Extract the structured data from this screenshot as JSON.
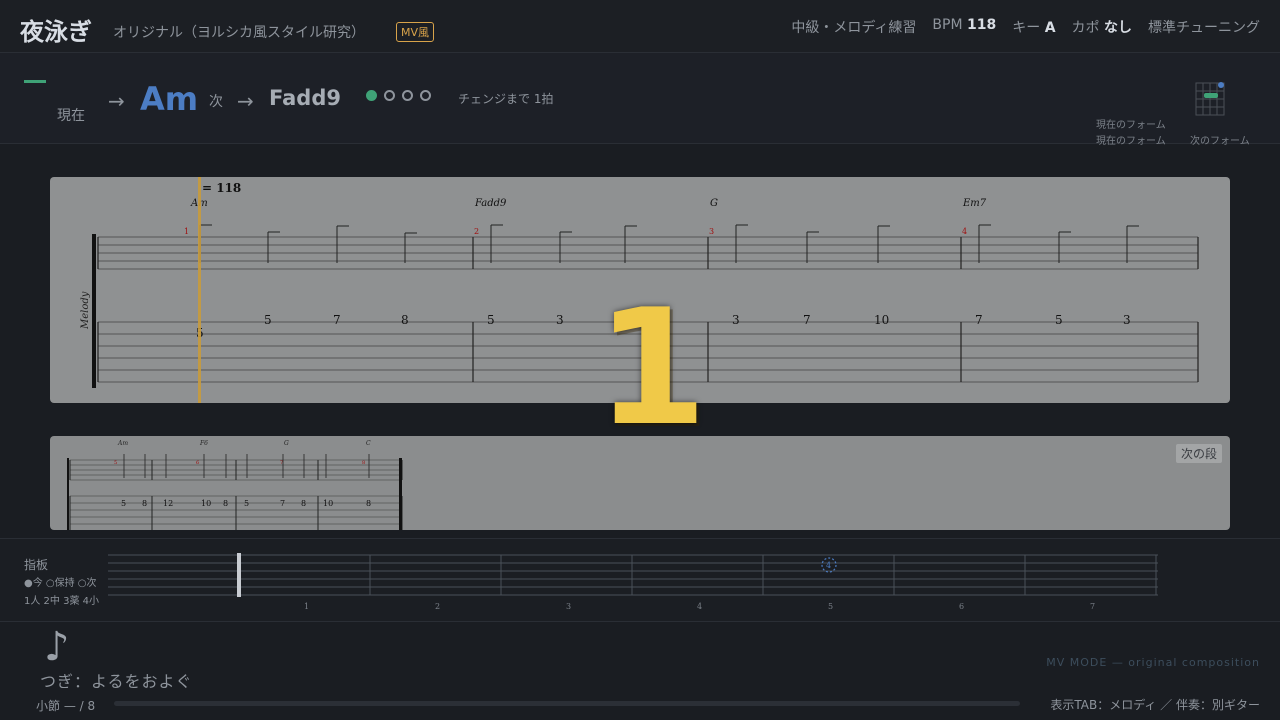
{
  "header": {
    "title": "夜泳ぎ",
    "subtitle": "オリジナル（ヨルシカ風スタイル研究）",
    "badge": "MV風",
    "level": "中級・メロディ練習",
    "bpm_label": "BPM",
    "bpm": "118",
    "key_label": "キー",
    "key": "A",
    "capo_label": "カポ",
    "capo": "なし",
    "tuning": "標準チューニング"
  },
  "chord_bar": {
    "now_label": "現在",
    "arrow": "→",
    "current_chord": "Am",
    "next_label": "次",
    "next_chord": "Fadd9",
    "beats": [
      true,
      false,
      false,
      false
    ],
    "until_change": "チェンジまで 1拍",
    "form_current_1": "現在のフォーム",
    "form_current_2": "現在のフォーム",
    "form_next": "次のフォーム",
    "accent_color": "#3fa277",
    "chord_color": "#4c7dc4"
  },
  "score": {
    "tempo": "= 118",
    "track_label": "Melody",
    "chords": [
      "Am",
      "Fadd9",
      "G",
      "Em7"
    ],
    "measure_numbers": [
      "1",
      "2",
      "3",
      "4"
    ],
    "measures": [
      [
        "5",
        "5",
        "7",
        "8"
      ],
      [
        "5",
        "3",
        "1",
        ""
      ],
      [
        "3",
        "7",
        "10"
      ],
      [
        "7",
        "5",
        "3"
      ]
    ],
    "playhead_color": "#c89b3c"
  },
  "next_system": {
    "label": "次の段",
    "chords": [
      "Am",
      "F6",
      "G",
      "C"
    ],
    "measure_numbers": [
      "5",
      "6",
      "7",
      "8"
    ],
    "measures": [
      [
        "5",
        "8",
        "12"
      ],
      [
        "10",
        "8",
        "5"
      ],
      [
        "7",
        "8",
        "10"
      ],
      [
        "8"
      ]
    ]
  },
  "countdown": "1",
  "fretboard": {
    "title": "指板",
    "legend": "●今 ○保持 ○次",
    "fingers": "1人 2中 3薬 4小",
    "fret_numbers": [
      "1",
      "2",
      "3",
      "4",
      "5",
      "6",
      "7"
    ],
    "marker_finger": "4"
  },
  "lyrics": {
    "note_icon": "♪",
    "next_line": "つぎ：よるをおよぐ"
  },
  "footer": {
    "measure": "小節 — / 8",
    "progress": 0.0,
    "tab_info": "表示TAB：メロディ ／ 伴奏：別ギター",
    "mv_mode": "MV MODE — original composition"
  }
}
